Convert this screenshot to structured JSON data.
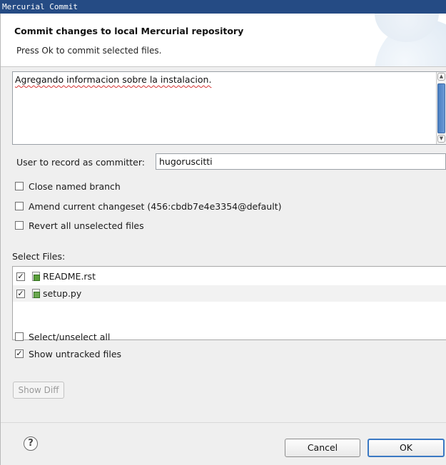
{
  "window": {
    "title": "Mercurial Commit"
  },
  "banner": {
    "title": "Commit changes to local Mercurial repository",
    "message": "Press Ok to commit selected files."
  },
  "commit_message": {
    "value": "Agregando informacion sobre la instalacion."
  },
  "committer": {
    "label": "User to record as committer:",
    "value": "hugoruscitti"
  },
  "options": {
    "close_branch": {
      "label": "Close named branch",
      "checked": false
    },
    "amend": {
      "label": "Amend current changeset (456:cbdb7e4e3354@default)",
      "checked": false
    },
    "revert": {
      "label": "Revert all unselected files",
      "checked": false
    }
  },
  "files": {
    "label": "Select Files:",
    "items": [
      {
        "name": "README.rst",
        "checked": true,
        "icon": "file-added-icon"
      },
      {
        "name": "setup.py",
        "checked": true,
        "icon": "python-file-added-icon"
      }
    ]
  },
  "bottom_options": {
    "select_all": {
      "label": "Select/unselect all",
      "checked": false
    },
    "show_untracked": {
      "label": "Show untracked files",
      "checked": true
    }
  },
  "buttons": {
    "show_diff": "Show Diff",
    "cancel": "Cancel",
    "ok": "OK",
    "help_glyph": "?"
  },
  "colors": {
    "titlebar": "#254b84",
    "ok_focus": "#3a78c3"
  }
}
